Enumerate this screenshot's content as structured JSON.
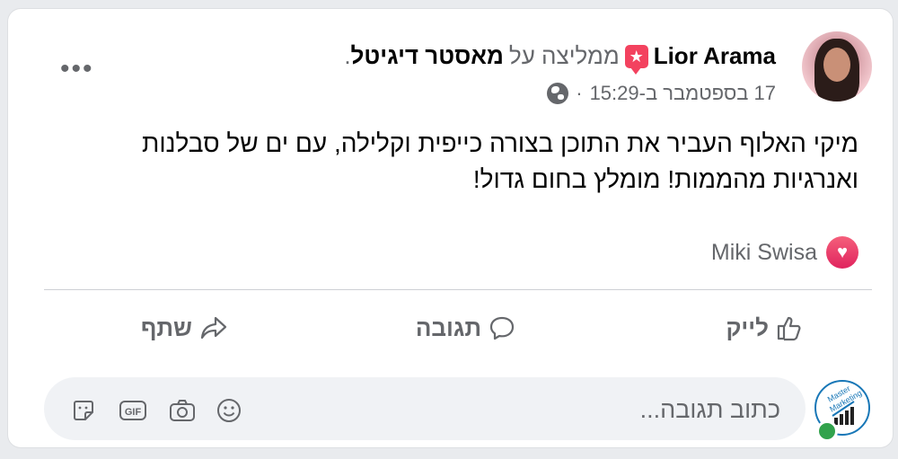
{
  "post": {
    "author": "Lior Arama",
    "recommend_text": "ממליצה על",
    "page_name": "מאסטר דיגיטל",
    "page_suffix": ".",
    "timestamp": "17 בספטמבר ב-15:29",
    "separator": "·",
    "text": "מיקי האלוף העביר את התוכן בצורה כייפית וקלילה, עם ים של סבלנות ואנרגיות מהממות! מומלץ בחום גדול!",
    "more_label": "•••"
  },
  "reactions": {
    "names": "Miki Swisa"
  },
  "actions": {
    "like": "לייק",
    "comment": "תגובה",
    "share": "שתף"
  },
  "composer": {
    "placeholder": "כתוב תגובה..."
  },
  "colors": {
    "accent_red": "#f3425f",
    "secondary_text": "#65676b",
    "online_green": "#31a24c"
  }
}
